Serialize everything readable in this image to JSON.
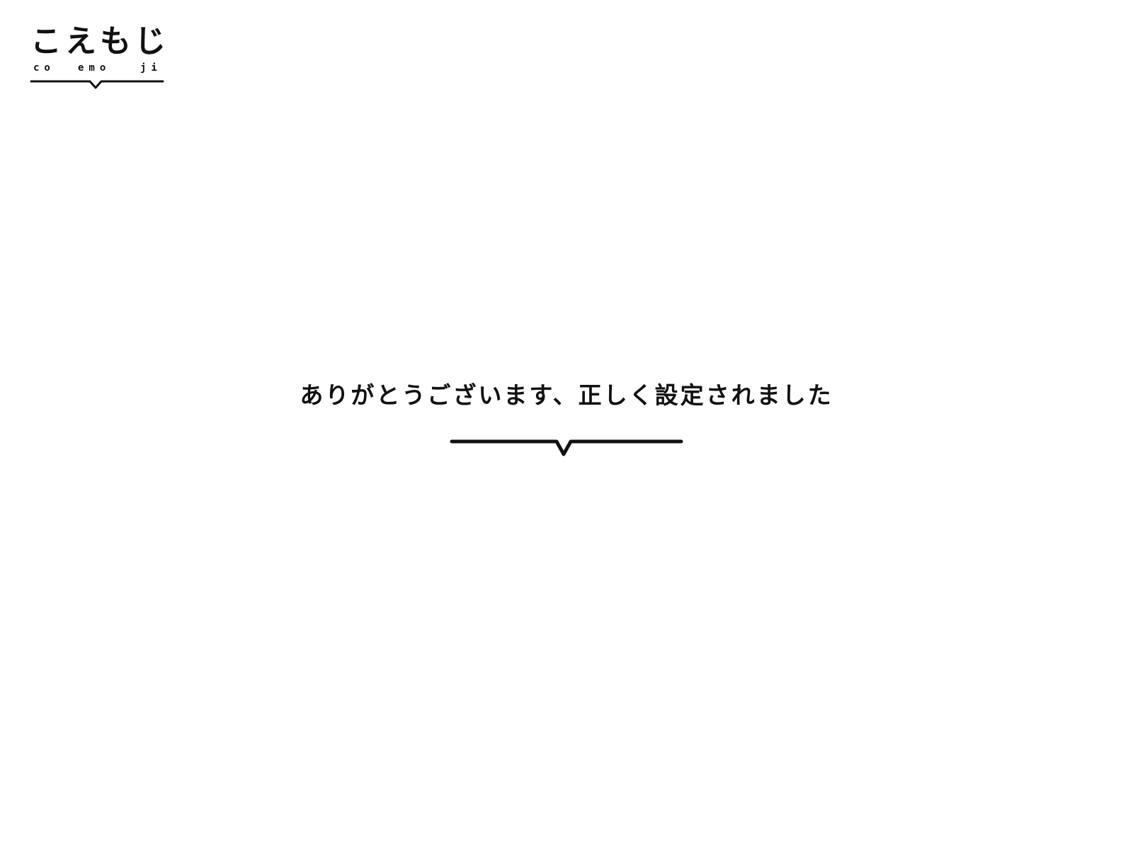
{
  "logo": {
    "title": "こえもじ",
    "subtitle_parts": [
      "co",
      "emo",
      "ji"
    ]
  },
  "message": {
    "text": "ありがとうございます、正しく設定されました"
  },
  "colors": {
    "background": "#ffffff",
    "text": "#111111",
    "line": "#111111"
  },
  "icons": {
    "logo_underline": "speech-bubble-line",
    "divider": "speech-bubble-line"
  }
}
